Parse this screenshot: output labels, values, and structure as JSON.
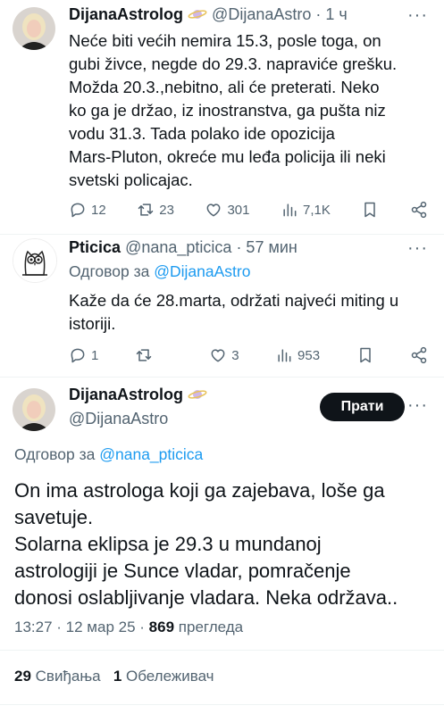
{
  "tweet1": {
    "name": "DijanaAstrolog",
    "badge_icon": "saturn-planet-icon",
    "handle": "@DijanaAstro",
    "time": "· 1 ч",
    "more_label": "···",
    "text_lines": [
      "Neće biti većih nemira 15.3, posle toga, on",
      "gubi živce, negde do 29.3. napraviće grešku.",
      "Možda 20.3.,nebitno, ali će preterati. Neko",
      "ko ga je držao, iz inostranstva, ga pušta niz",
      "vodu 31.3. Tada polako ide opozicija",
      "Mars-Pluton, okreće mu leđa policija ili neki",
      "svetski policajac."
    ],
    "replies": "12",
    "retweets": "23",
    "likes": "301",
    "views": "7,1K"
  },
  "tweet2": {
    "name": "Pticica",
    "handle": "@nana_pticica",
    "time": "· 57 мин",
    "more_label": "···",
    "reply_prefix": "Одговор за",
    "reply_to": "@DijanaAstro",
    "text_lines": [
      "Kaže da će 28.marta, održati najveći miting u",
      "istoriji."
    ],
    "replies": "1",
    "retweets": "",
    "likes": "3",
    "views": "953"
  },
  "tweet3": {
    "name": "DijanaAstrolog",
    "handle": "@DijanaAstro",
    "follow_label": "Прати",
    "reply_prefix": "Одговор за",
    "reply_to": "@nana_pticica",
    "text_lines": [
      "On ima astrologa koji ga zajebava, loše ga",
      "savetuje.",
      "Solarna eklipsa je 29.3 u mundanoj",
      "astrologiji je Sunce vladar, pomračenje",
      "donosi oslabljivanje vladara. Neka održava.."
    ],
    "time": "13:27",
    "date": "12 мар 25",
    "view_count": "869",
    "views_label": "прегледа",
    "likes_count": "29",
    "likes_label": "Свиђања",
    "bookmarks_count": "1",
    "bookmarks_label": "Обележивач"
  },
  "colors": {
    "link": "#1d9bf0",
    "muted": "#536471",
    "text": "#0f1419",
    "button": "#0f1419"
  }
}
